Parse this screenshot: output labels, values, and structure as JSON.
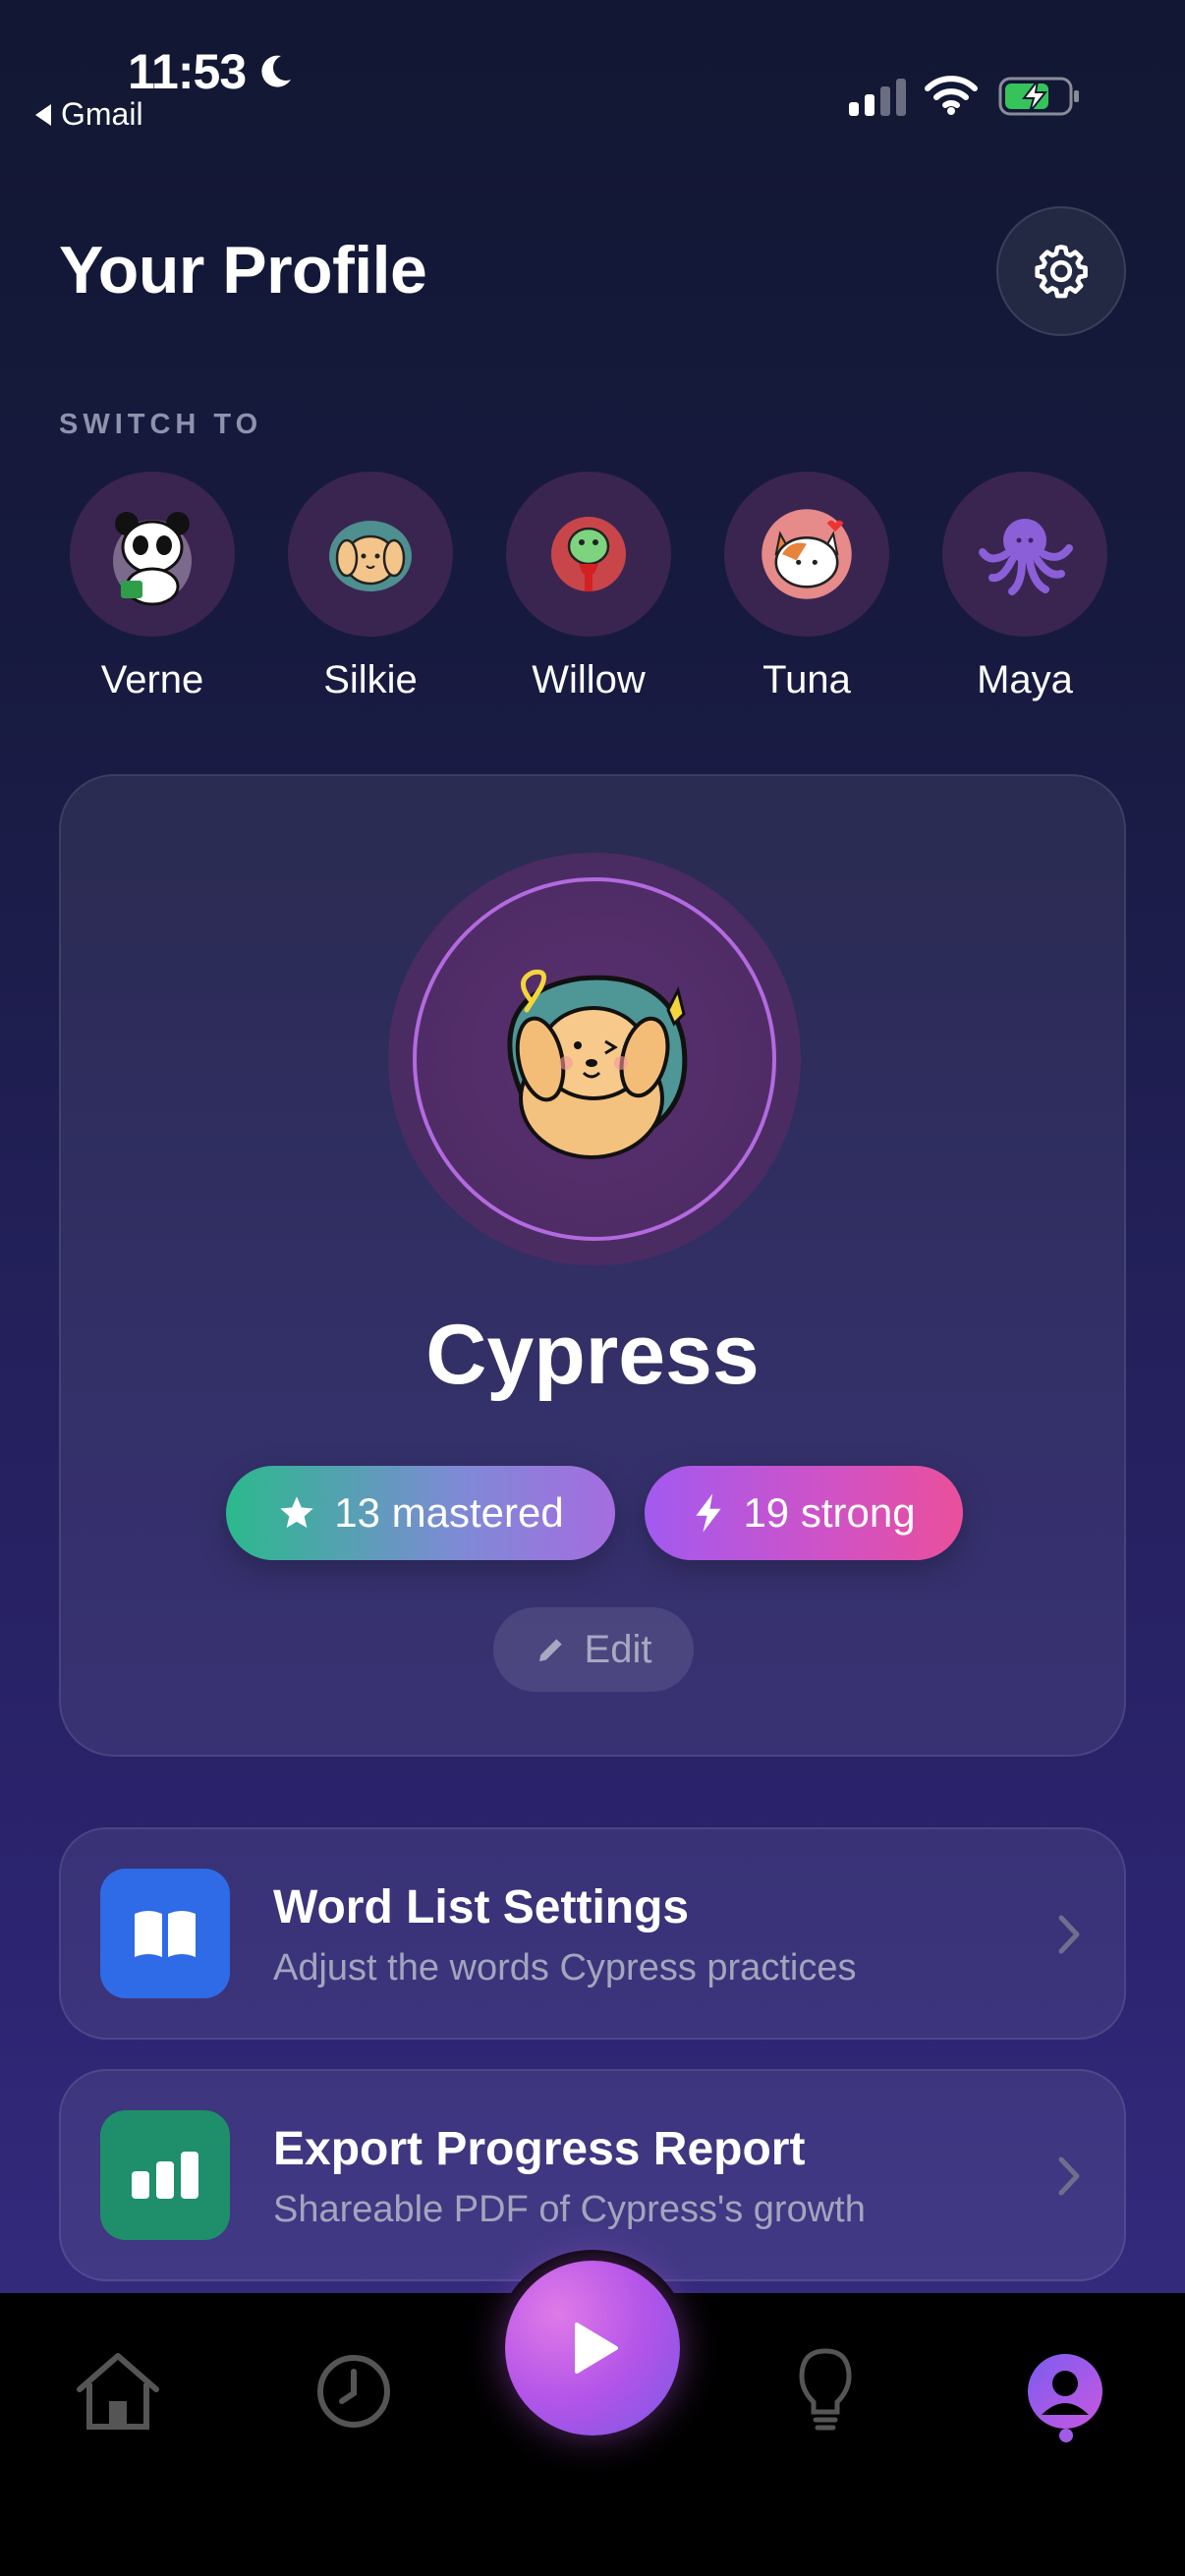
{
  "status_bar": {
    "time": "11:53",
    "back_label": "Gmail",
    "icons": [
      "moon-icon",
      "signal-icon",
      "wifi-icon",
      "battery-charging-icon"
    ]
  },
  "header": {
    "title": "Your Profile",
    "settings_icon": "gear-icon"
  },
  "switch_to": {
    "label": "SWITCH TO",
    "profiles": [
      {
        "name": "Verne",
        "avatar": "panda-avatar"
      },
      {
        "name": "Silkie",
        "avatar": "puppy-avatar"
      },
      {
        "name": "Willow",
        "avatar": "snake-avatar"
      },
      {
        "name": "Tuna",
        "avatar": "cat-avatar"
      },
      {
        "name": "Maya",
        "avatar": "octopus-avatar"
      }
    ]
  },
  "profile": {
    "name": "Cypress",
    "avatar": "puppy-avatar",
    "mastered_label": "13 mastered",
    "strong_label": "19 strong",
    "edit_label": "Edit"
  },
  "options": [
    {
      "title": "Word List Settings",
      "subtitle": "Adjust the words Cypress practices",
      "icon": "book-icon",
      "icon_color": "#2f6be6"
    },
    {
      "title": "Export Progress Report",
      "subtitle": "Shareable PDF of Cypress's growth",
      "icon": "bar-chart-icon",
      "icon_color": "#1e8f6a"
    }
  ],
  "bottom_nav": {
    "items": [
      "home-icon",
      "history-clock-icon",
      "play-icon",
      "lightbulb-icon",
      "profile-icon"
    ],
    "active": "profile-icon"
  },
  "colors": {
    "accent_purple": "#a15be8",
    "mastered_green": "#2bb98c",
    "strong_pink": "#ea4f9a",
    "card_background": "#2a2a4a"
  }
}
